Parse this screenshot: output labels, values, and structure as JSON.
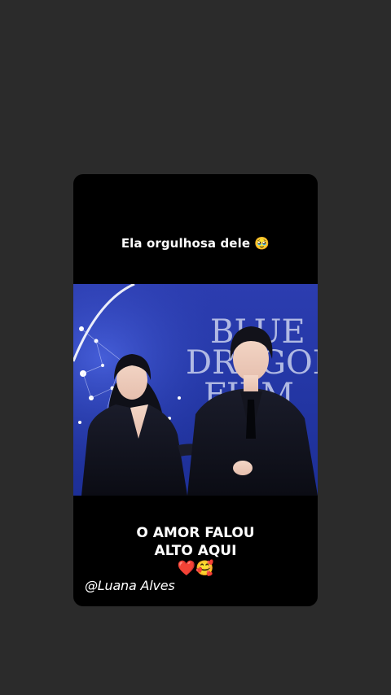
{
  "story": {
    "caption_top": "Ela orgulhosa dele 🥹",
    "photo": {
      "backdrop_text": [
        "BLUE",
        "DRAGON",
        "FILM"
      ],
      "alt": "couple at film awards red carpet"
    },
    "caption_bottom_line1": "O AMOR FALOU",
    "caption_bottom_line2": "ALTO AQUI",
    "emoji_heart": "❤️",
    "emoji_love": "🥰",
    "watermark": "@Luana Alves"
  },
  "colors": {
    "page_background": "#2b2b2b",
    "card_background": "#000000",
    "photo_blue": "#2437a6",
    "text": "#ffffff"
  }
}
